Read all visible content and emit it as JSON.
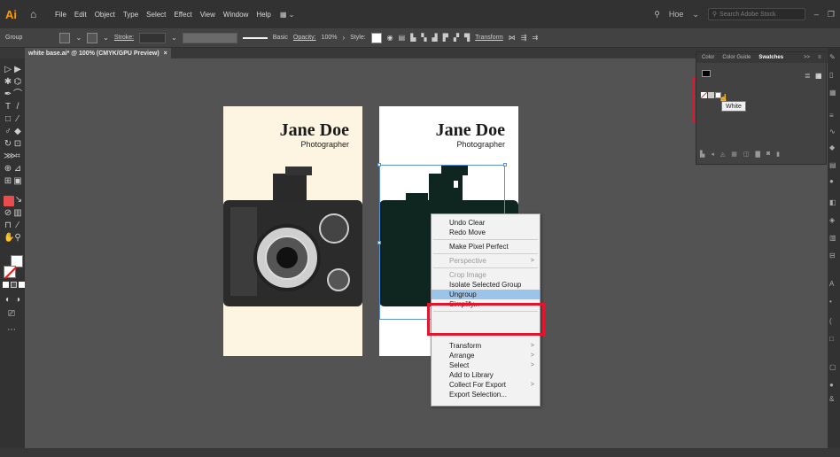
{
  "app": {
    "logo": "Ai",
    "home_icon": "home-icon"
  },
  "menu": {
    "items": [
      "File",
      "Edit",
      "Object",
      "Type",
      "Select",
      "Effect",
      "View",
      "Window",
      "Help"
    ],
    "workspace_icon": "workspace-switcher-icon"
  },
  "topright": {
    "user": "Hoe",
    "search_placeholder": "Search Adobe Stock"
  },
  "controlbar": {
    "mode": "Group",
    "stroke_label": "Stroke:",
    "brush_label": "Basic",
    "opacity_label": "Opacity:",
    "opacity_value": "100%",
    "style_label": "Style:",
    "transform_label": "Transform"
  },
  "document": {
    "tab_title": "white base.ai* @ 100% (CMYK/GPU Preview)",
    "close": "×"
  },
  "cards": [
    {
      "name": "Jane Doe",
      "role": "Photographer",
      "background": "#fdf4e2"
    },
    {
      "name": "Jane Doe",
      "role": "Photographer",
      "background": "#ffffff"
    }
  ],
  "context_menu": {
    "items": [
      {
        "label": "Undo Clear",
        "enabled": true
      },
      {
        "label": "Redo Move",
        "enabled": true
      },
      {
        "label": "Make Pixel Perfect",
        "enabled": true
      },
      {
        "label": "Perspective",
        "enabled": false,
        "submenu": true
      },
      {
        "label": "Crop Image",
        "enabled": false
      },
      {
        "label": "Isolate Selected Group",
        "enabled": true
      },
      {
        "label": "Ungroup",
        "enabled": true,
        "highlighted": true
      },
      {
        "label": "Simplify...",
        "enabled": true
      },
      {
        "label": "Transform",
        "enabled": true,
        "submenu": true
      },
      {
        "label": "Arrange",
        "enabled": true,
        "submenu": true
      },
      {
        "label": "Select",
        "enabled": true,
        "submenu": true
      },
      {
        "label": "Add to Library",
        "enabled": true
      },
      {
        "label": "Collect For Export",
        "enabled": true,
        "submenu": true
      },
      {
        "label": "Export Selection...",
        "enabled": true
      }
    ],
    "submenu_arrow": ">"
  },
  "swatches_panel": {
    "tabs": [
      "Color",
      "Color Guide",
      "Swatches"
    ],
    "active_tab": "Swatches",
    "tooltip": "White",
    "more": ">>"
  },
  "colors": {
    "highlight_red": "#e5132b",
    "menu_highlight": "#9cc4e8",
    "accent_orange": "#ff9a00",
    "fill_red": "#e84c4c"
  }
}
